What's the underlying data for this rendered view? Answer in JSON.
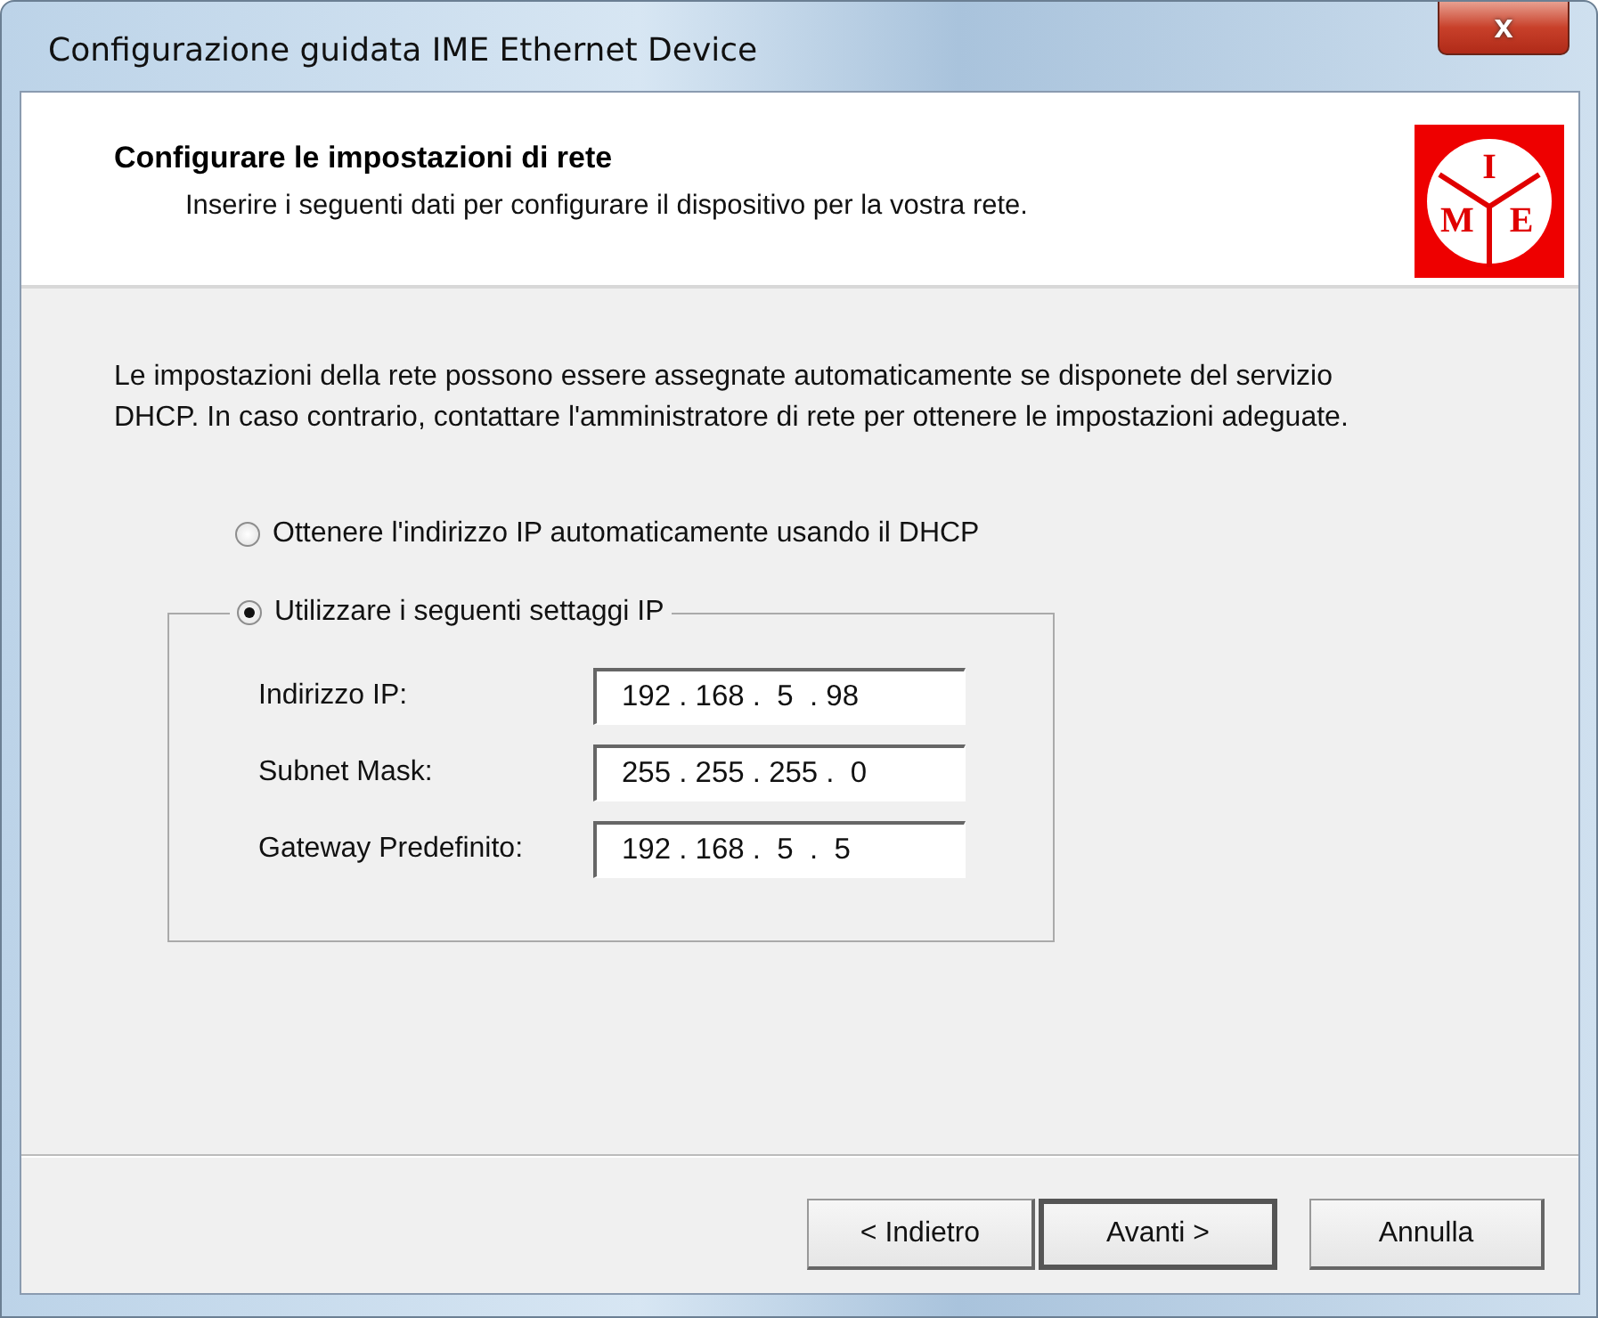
{
  "window": {
    "title": "Configurazione guidata IME Ethernet Device",
    "close_label": "x"
  },
  "header": {
    "title": "Configurare le impostazioni di rete",
    "subtitle": "Inserire i seguenti dati per configurare il dispositivo per la vostra rete.",
    "logo_letters": [
      "I",
      "M",
      "E"
    ]
  },
  "description": "Le impostazioni della rete possono essere assegnate automaticamente se disponete del servizio DHCP.  In caso contrario, contattare l'amministratore di rete per ottenere le impostazioni adeguate.",
  "options": [
    {
      "label": "Ottenere l'indirizzo IP automaticamente usando il DHCP",
      "selected": false
    },
    {
      "label": "Utilizzare i seguenti settaggi IP",
      "selected": true
    }
  ],
  "fields": [
    {
      "label": "Indirizzo IP:",
      "value": "192 . 168 .  5  . 98"
    },
    {
      "label": "Subnet Mask:",
      "value": "255 . 255 . 255 .  0"
    },
    {
      "label": "Gateway Predefinito:",
      "value": "192 . 168 .  5  .  5"
    }
  ],
  "buttons": [
    {
      "label": "< Indietro",
      "default": false
    },
    {
      "label": "Avanti >",
      "default": true
    },
    {
      "label": "Annulla",
      "default": false
    }
  ]
}
